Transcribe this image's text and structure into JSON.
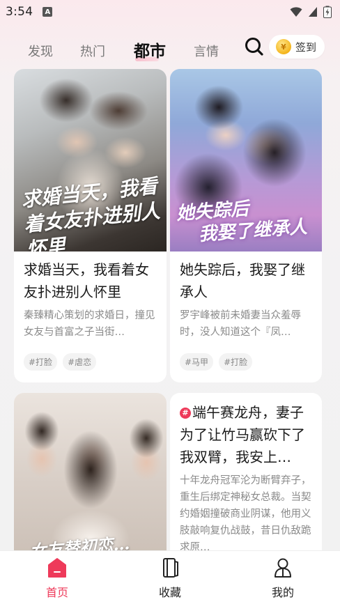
{
  "status_bar": {
    "time": "3:54",
    "notification_letter": "A"
  },
  "nav": {
    "tabs": [
      {
        "label": "发现"
      },
      {
        "label": "热门"
      },
      {
        "label": "都市"
      },
      {
        "label": "言情"
      }
    ],
    "active_tab": "都市",
    "signin_label": "签到"
  },
  "books": [
    {
      "title": "求婚当天，我看着女友扑进别人怀里",
      "cover_text": "求婚当天，我看着女友扑进别人怀里",
      "description": "秦臻精心策划的求婚日，撞见女友与首富之子当街…",
      "tags": [
        "#打脸",
        "#虐恋"
      ]
    },
    {
      "title": "她失踪后，我娶了继承人",
      "cover_text_line1": "她失踪后",
      "cover_text_line2": "我娶了继承人",
      "description": "罗宇峰被前未婚妻当众羞辱时，没人知道这个『凤…",
      "tags": [
        "#马甲",
        "#打脸"
      ]
    },
    {
      "title": "",
      "cover_text": "女友替初恋…",
      "description": "",
      "tags": []
    },
    {
      "badge": "#",
      "title": "端午赛龙舟，妻子为了让竹马赢砍下了我双臂，我安上…",
      "description": "十年龙舟冠军沦为断臂弃子，重生后绑定神秘女总裁。当契约婚姻撞破商业阴谋，他用义肢敲响复仇战鼓，昔日仇敌跪求原…",
      "tags": []
    }
  ],
  "bottom_nav": {
    "items": [
      {
        "label": "首页",
        "icon": "home-icon"
      },
      {
        "label": "收藏",
        "icon": "bookshelf-icon"
      },
      {
        "label": "我的",
        "icon": "profile-icon"
      }
    ],
    "active": "首页"
  },
  "colors": {
    "accent": "#ee3a5a",
    "page_bg_top": "#fbe9ed"
  }
}
